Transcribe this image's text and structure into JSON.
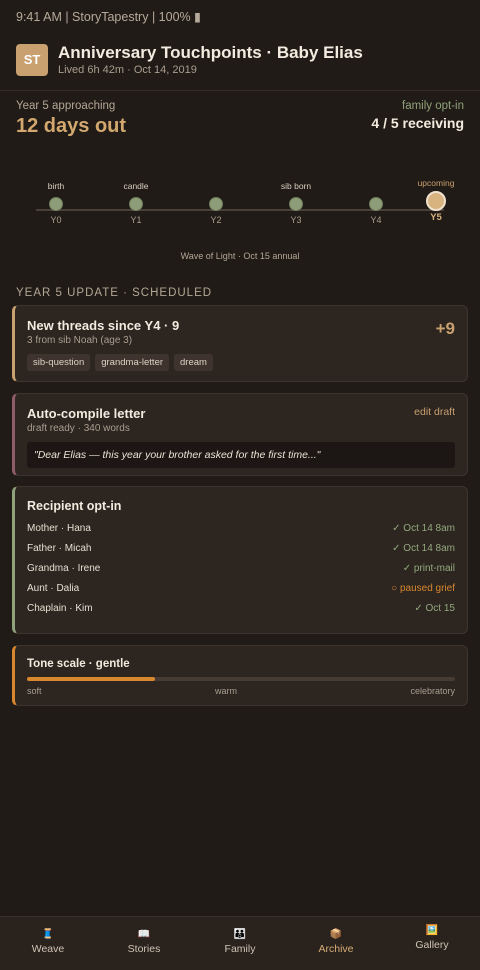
{
  "status_bar": "9:41 AM | StoryTapestry | 100% ▮",
  "header": {
    "avatar": "ST",
    "title": "Anniversary Touchpoints · Baby Elias",
    "subtitle": "Lived 6h 42m · Oct 14, 2019"
  },
  "countdown": {
    "label": "Year 5 approaching",
    "value": "12 days out"
  },
  "optin": {
    "label": "family opt-in",
    "value": "4 / 5 receiving"
  },
  "timeline": {
    "nodes": [
      {
        "top": "birth",
        "bottom": "Y0"
      },
      {
        "top": "candle",
        "bottom": "Y1"
      },
      {
        "top": "",
        "bottom": "Y2"
      },
      {
        "top": "sib born",
        "bottom": "Y3"
      },
      {
        "top": "",
        "bottom": "Y4"
      },
      {
        "top": "upcoming",
        "bottom": "Y5"
      }
    ],
    "caption": "Wave of Light · Oct 15 annual"
  },
  "section_title": "YEAR 5 UPDATE · SCHEDULED",
  "threads_card": {
    "title": "New threads since Y4 · 9",
    "subtitle": "3 from sib Noah (age 3)",
    "count": "+9",
    "tags": [
      "sib-question",
      "grandma-letter",
      "dream"
    ]
  },
  "letter_card": {
    "title": "Auto-compile letter",
    "subtitle": "draft ready · 340 words",
    "edit_label": "edit draft",
    "quote": "\"Dear Elias — this year your brother asked for the first time...\""
  },
  "recipients_card": {
    "title": "Recipient opt-in",
    "rows": [
      {
        "name": "Mother · Hana",
        "status": "✓ Oct 14 8am",
        "kind": "ok"
      },
      {
        "name": "Father · Micah",
        "status": "✓ Oct 14 8am",
        "kind": "ok"
      },
      {
        "name": "Grandma · Irene",
        "status": "✓ print-mail",
        "kind": "ok"
      },
      {
        "name": "Aunt · Dalia",
        "status": "○ paused grief",
        "kind": "paused"
      },
      {
        "name": "Chaplain · Kim",
        "status": "✓ Oct 15",
        "kind": "ok"
      }
    ]
  },
  "tone_card": {
    "title": "Tone scale · gentle",
    "level": 0.3,
    "labels": [
      "soft",
      "warm",
      "celebratory"
    ]
  },
  "nav": [
    {
      "icon": "🧵",
      "icon_name": "weave-icon",
      "label": "Weave"
    },
    {
      "icon": "📖",
      "icon_name": "stories-icon",
      "label": "Stories"
    },
    {
      "icon": "👪",
      "icon_name": "family-icon",
      "label": "Family"
    },
    {
      "icon": "📦",
      "icon_name": "archive-icon",
      "label": "Archive",
      "active": true
    },
    {
      "icon": "🖼️",
      "icon_name": "gallery-icon",
      "label": "Gallery"
    }
  ],
  "colors": {
    "background": "#211b17",
    "accent_gold": "#c9a06f",
    "accent_green": "#8fa27a",
    "accent_mauve": "#8e5c6b",
    "accent_orange": "#d8872f"
  }
}
